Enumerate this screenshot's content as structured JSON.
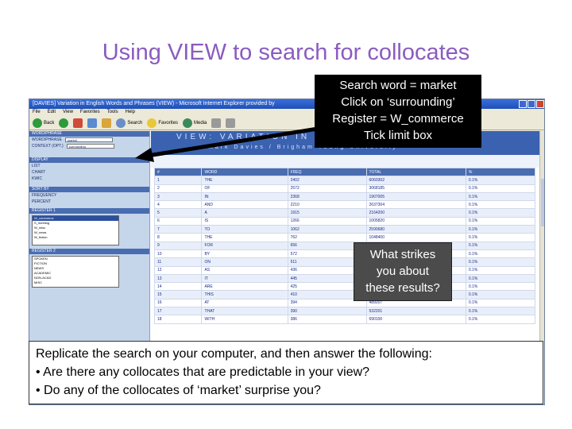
{
  "slide": {
    "title": "Using VIEW to search for collocates"
  },
  "browser": {
    "window_title": "[DAVIES] Variation in English Words and Phrases (VIEW) - Microsoft Internet Explorer provided by",
    "menu": [
      "File",
      "Edit",
      "View",
      "Favorites",
      "Tools",
      "Help"
    ],
    "toolbar": [
      "Back",
      "Search",
      "Favorites",
      "Media"
    ],
    "sidebar": {
      "header": "WORD/PHRASE",
      "word_value": "market",
      "context_label": "CONTEXT (OPT.)",
      "context_value": "surrounding",
      "section_display": "DISPLAY",
      "options": [
        "LIST",
        "CHART",
        "KWIC"
      ],
      "section_sort": "SORT BY",
      "sort_options": [
        "FREQUENCY",
        "PERCENT"
      ],
      "section_register1": "REGISTER 1",
      "register1_items": [
        "W_commerce",
        "S_meeting",
        "W_misc",
        "W_news",
        "W_fiction"
      ],
      "section_register2": "REGISTER 2",
      "register2_items": [
        "SPOKEN",
        "FICTION",
        "NEWS",
        "ACADEMIC",
        "NON-ACAD",
        "MISC"
      ]
    },
    "banner": {
      "line1": "VIEW: VARIATION IN ENGLISH",
      "line2": "Mark Davies / Brigham Young University"
    },
    "columns": [
      "#",
      "WORD",
      "FREQ",
      "TOTAL",
      "%"
    ],
    "rows": [
      [
        "1",
        "THE",
        "2402",
        "6060302",
        "0.1%"
      ],
      [
        "2",
        "OF",
        "2572",
        "3068185",
        "0.1%"
      ],
      [
        "3",
        "IN",
        "2368",
        "1907005",
        "0.1%"
      ],
      [
        "4",
        "AND",
        "2210",
        "2637304",
        "0.1%"
      ],
      [
        "5",
        "A",
        "1915",
        "2164200",
        "0.1%"
      ],
      [
        "6",
        "IS",
        "1266",
        "1005820",
        "0.1%"
      ],
      [
        "7",
        "TO",
        "1062",
        "2590680",
        "0.1%"
      ],
      [
        "8",
        "THE",
        "762",
        "1048400",
        "0.1%"
      ],
      [
        "9",
        "FOR",
        "656",
        "831305",
        "0.1%"
      ],
      [
        "10",
        "BY",
        "572",
        "546110",
        "0.1%"
      ],
      [
        "11",
        "ON",
        "511",
        "700000",
        "0.1%"
      ],
      [
        "12",
        "AS",
        "436",
        "580060",
        "0.1%"
      ],
      [
        "13",
        "IT",
        "445",
        "830006",
        "0.1%"
      ],
      [
        "14",
        "ARE",
        "425",
        "465306",
        "0.1%"
      ],
      [
        "15",
        "THIS",
        "410",
        "460000",
        "0.1%"
      ],
      [
        "16",
        "AT",
        "394",
        "489207",
        "0.1%"
      ],
      [
        "17",
        "THAT",
        "390",
        "532201",
        "0.1%"
      ],
      [
        "18",
        "WITH",
        "386",
        "690100",
        "0.1%"
      ]
    ]
  },
  "callouts": {
    "search": [
      "Search word = market",
      "Click on ‘surrounding’",
      "Register = W_commerce",
      "Tick limit box"
    ],
    "results": [
      "What strikes",
      "you about",
      "these results?"
    ]
  },
  "instructions": [
    "Replicate the search on your computer, and then answer the following:",
    "• Are there any collocates that are predictable in your view?",
    "• Do any of the collocates of ‘market’ surprise you?"
  ],
  "colors": {
    "title": "#8a5cc0",
    "callout_search_bg": "#000000",
    "callout_results_bg": "#4b4b4b"
  }
}
